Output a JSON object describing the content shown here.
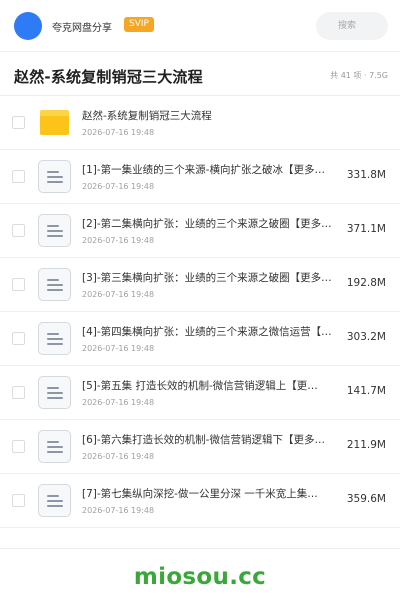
{
  "topbar": {
    "app_name": "夸克网盘分享",
    "vip_badge": "SVIP",
    "search_placeholder": "搜索"
  },
  "header": {
    "title": "赵然-系统复制销冠三大流程",
    "meta": "共 41 项 · 7.5G"
  },
  "files": [
    {
      "type": "folder",
      "name": "赵然-系统复制销冠三大流程",
      "date": "2026-07-16 19:48",
      "size": ""
    },
    {
      "type": "file",
      "name": "[1]-第一集业绩的三个来源-横向扩张之破冰【更多…",
      "date": "2026-07-16 19:48",
      "size": "331.8M"
    },
    {
      "type": "file",
      "name": "[2]-第二集横向扩张：业绩的三个来源之破圈【更多…",
      "date": "2026-07-16 19:48",
      "size": "371.1M"
    },
    {
      "type": "file",
      "name": "[3]-第三集横向扩张：业绩的三个来源之破圈【更多…",
      "date": "2026-07-16 19:48",
      "size": "192.8M"
    },
    {
      "type": "file",
      "name": "[4]-第四集横向扩张：业绩的三个来源之微信运营【…",
      "date": "2026-07-16 19:48",
      "size": "303.2M"
    },
    {
      "type": "file",
      "name": "[5]-第五集 打造长效的机制-微信营销逻辑上【更…",
      "date": "2026-07-16 19:48",
      "size": "141.7M"
    },
    {
      "type": "file",
      "name": "[6]-第六集打造长效的机制-微信营销逻辑下【更多…",
      "date": "2026-07-16 19:48",
      "size": "211.9M"
    },
    {
      "type": "file",
      "name": "[7]-第七集纵向深挖-做一公里分深 一千米宽上集…",
      "date": "2026-07-16 19:48",
      "size": "359.6M"
    }
  ],
  "watermark": "miosou.cc",
  "colors": {
    "accent_blue": "#2f7bf5",
    "vip_orange": "#f5a623",
    "folder_yellow": "#fcc419",
    "watermark_green": "#3aa838"
  }
}
